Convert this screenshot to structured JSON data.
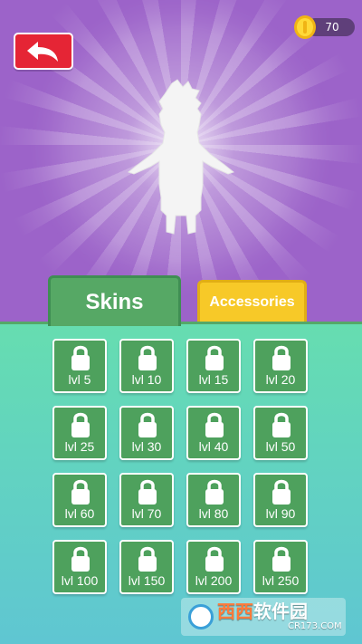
{
  "header": {
    "coins": "70",
    "back_icon": "back-arrow-icon",
    "coin_icon": "coin-icon"
  },
  "tabs": [
    {
      "label": "Skins",
      "active": true
    },
    {
      "label": "Accessories",
      "active": false
    }
  ],
  "skins": [
    {
      "label": "lvl 5",
      "locked": true
    },
    {
      "label": "lvl 10",
      "locked": true
    },
    {
      "label": "lvl 15",
      "locked": true
    },
    {
      "label": "lvl 20",
      "locked": true
    },
    {
      "label": "lvl 25",
      "locked": true
    },
    {
      "label": "lvl 30",
      "locked": true
    },
    {
      "label": "lvl 40",
      "locked": true
    },
    {
      "label": "lvl 50",
      "locked": true
    },
    {
      "label": "lvl 60",
      "locked": true
    },
    {
      "label": "lvl 70",
      "locked": true
    },
    {
      "label": "lvl 80",
      "locked": true
    },
    {
      "label": "lvl 90",
      "locked": true
    },
    {
      "label": "lvl 100",
      "locked": true
    },
    {
      "label": "lvl 150",
      "locked": true
    },
    {
      "label": "lvl 200",
      "locked": true
    },
    {
      "label": "lvl 250",
      "locked": true
    }
  ],
  "watermark": {
    "brand": "西西软件园",
    "brand_accent": "西西",
    "brand_rest": "软件园",
    "url": "CR173.COM"
  },
  "colors": {
    "background_purple": "#9c63c9",
    "back_button": "#e52535",
    "skins_tab": "#56a865",
    "accessories_tab": "#f7c928",
    "tile_green": "#4ea15d",
    "panel_top": "#66ddb0",
    "panel_bottom": "#5fc6d2"
  }
}
